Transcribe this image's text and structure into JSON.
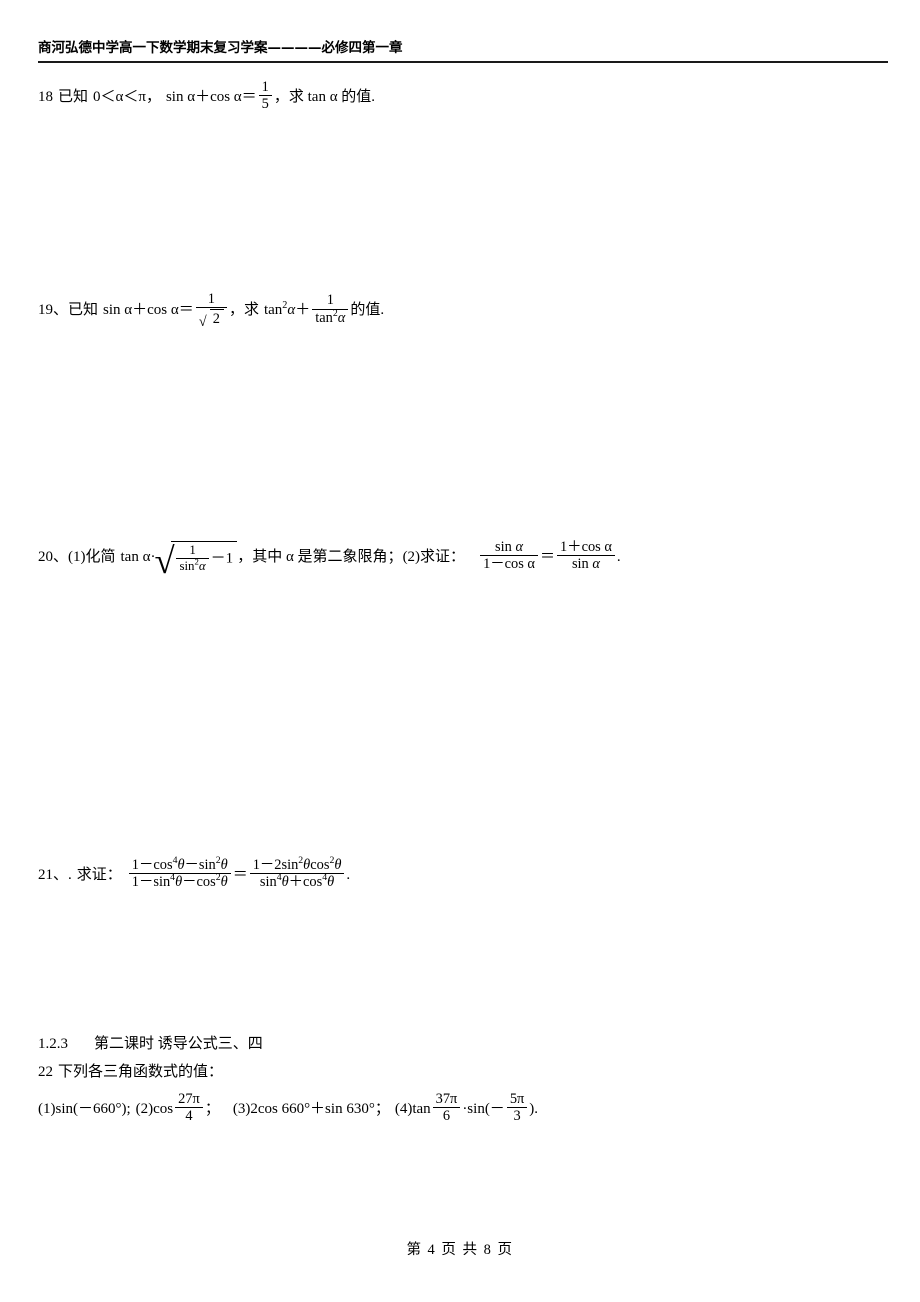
{
  "document": {
    "header_title": "商河弘德中学高一下数学期末复习学案————必修四第一章",
    "footer_text": "第 4 页 共 8 页"
  },
  "problems": {
    "p18": {
      "number": "18",
      "text_known": "已知",
      "range": "0＜α＜π，",
      "expr_lhs": "sin α＋cos α＝",
      "frac_num": "1",
      "frac_den": "5",
      "tail": "，求 tan α 的值."
    },
    "p19": {
      "number": "19、",
      "text_known": "已知",
      "expr_lhs": "sin α＋cos α＝",
      "frac_num": "1",
      "frac_den_root": "2",
      "mid": "，求",
      "term1": "tan",
      "term1_exp": "2",
      "term1_var": "α",
      "plus": "＋",
      "frac2_num": "1",
      "frac2_den_fn": "tan",
      "frac2_den_exp": "2",
      "frac2_den_var": "α",
      "tail": "的值."
    },
    "p20": {
      "number": "20、",
      "part1_label": "(1)化简",
      "part1_lead": "tan α·",
      "radicand_num": "1",
      "radicand_den_fn": "sin",
      "radicand_den_exp": "2",
      "radicand_den_var": "α",
      "radicand_tail": "－1",
      "part1_tail": "，其中 α 是第二象限角；",
      "part2_label": "(2)求证：",
      "lhs_num_fn": "sin",
      "lhs_num_var": "α",
      "lhs_den": "1－cos α",
      "equals": "＝",
      "rhs_num": "1＋cos α",
      "rhs_den_fn": "sin",
      "rhs_den_var": "α",
      "period": "."
    },
    "p21": {
      "number": "21、.",
      "label": "求证：",
      "lhs_num_a": "1－cos",
      "lhs_num_a_exp": "4",
      "lhs_num_a_var": "θ",
      "lhs_num_b": "－sin",
      "lhs_num_b_exp": "2",
      "lhs_num_b_var": "θ",
      "lhs_den_a": "1－sin",
      "lhs_den_a_exp": "4",
      "lhs_den_a_var": "θ",
      "lhs_den_b": "－cos",
      "lhs_den_b_exp": "2",
      "lhs_den_b_var": "θ",
      "equals": "＝",
      "rhs_num_a": "1－2sin",
      "rhs_num_a_exp": "2",
      "rhs_num_a_var": "θ",
      "rhs_num_b": "cos",
      "rhs_num_b_exp": "2",
      "rhs_num_b_var": "θ",
      "rhs_den_a": "sin",
      "rhs_den_a_exp": "4",
      "rhs_den_a_var": "θ",
      "rhs_den_b": "＋cos",
      "rhs_den_b_exp": "4",
      "rhs_den_b_var": "θ",
      "period": "."
    },
    "p22": {
      "number": "22",
      "stem": "下列各三角函数式的值：",
      "item1": "(1)sin(－660°);",
      "item2_lead": "(2)cos",
      "item2_num": "27π",
      "item2_den": "4",
      "item2_tail": "；",
      "item3": "(3)2cos 660°＋sin 630°；",
      "item4_lead": "(4)tan",
      "item4_num": "37π",
      "item4_den": "6",
      "item4_mid": "·sin(－",
      "item4_num2": "5π",
      "item4_den2": "3",
      "item4_tail": ")."
    }
  },
  "section": {
    "code": "1.2.3",
    "title": "第二课时  诱导公式三、四"
  }
}
